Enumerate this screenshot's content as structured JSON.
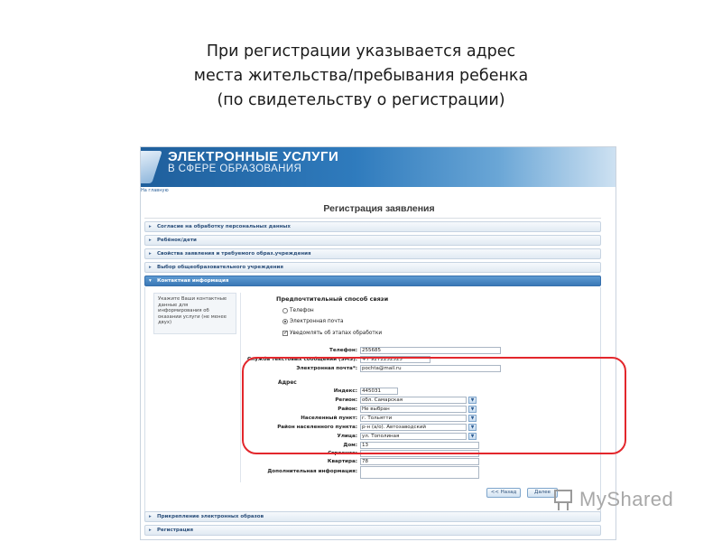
{
  "caption": {
    "line1": "При регистрации указывается адрес",
    "line2": "места жительства/пребывания ребенка",
    "line3": "(по свидетельству о регистрации)"
  },
  "portal": {
    "banner_line1": "ЭЛЕКТРОННЫЕ УСЛУГИ",
    "banner_line2": "В СФЕРЕ ОБРАЗОВАНИЯ",
    "home_link": "На главную",
    "page_title": "Регистрация заявления"
  },
  "sections": {
    "consent": "Согласие на обработку персональных данных",
    "child": "Ребёнок/дети",
    "properties": "Свойства заявления и требуемого образ.учреждения",
    "school": "Выбор общеобразовательного учреждения",
    "contact": "Контактная информация",
    "attach": "Прикрепление электронных образов",
    "registration": "Регистрация"
  },
  "contact": {
    "help_text": "Укажите Ваши контактные данные для информирования об оказании услуги (не менее двух)",
    "pref_title": "Предпочтительный способ связи",
    "opt_phone": "Телефон",
    "opt_email": "Электронная почта",
    "opt_notify": "Уведомлять об этапах обработки",
    "phone_label": "Телефон:",
    "phone_value": "255685",
    "sms_label": "Служба текстовых сообщений (SMS):",
    "sms_value": "+7 9272252525",
    "email_label": "Электронная почта*:",
    "email_value": "pochta@mail.ru"
  },
  "address": {
    "title": "Адрес",
    "index_label": "Индекс:",
    "index_value": "445031",
    "region_label": "Регион:",
    "region_value": "обл. Самарская",
    "district_label": "Район:",
    "district_value": "Не выбран",
    "locality_label": "Населенный пункт:",
    "locality_value": "г. Тольятти",
    "locality_district_label": "Район населенного пункта:",
    "locality_district_value": "р-н (а/о). Автозаводский",
    "street_label": "Улица:",
    "street_value": "ул. Тополиная",
    "house_label": "Дом:",
    "house_value": "13",
    "building_label": "Строение:",
    "building_value": "",
    "flat_label": "Квартира:",
    "flat_value": "78",
    "extra_label": "Дополнительная информация:",
    "dropdown_glyph": "▼"
  },
  "nav": {
    "back": "<< Назад",
    "next": "Далее"
  },
  "watermark": "MyShared",
  "colors": {
    "highlight": "#e3272c",
    "active_section": "#3a78b6",
    "banner": "#1f5f9c"
  }
}
